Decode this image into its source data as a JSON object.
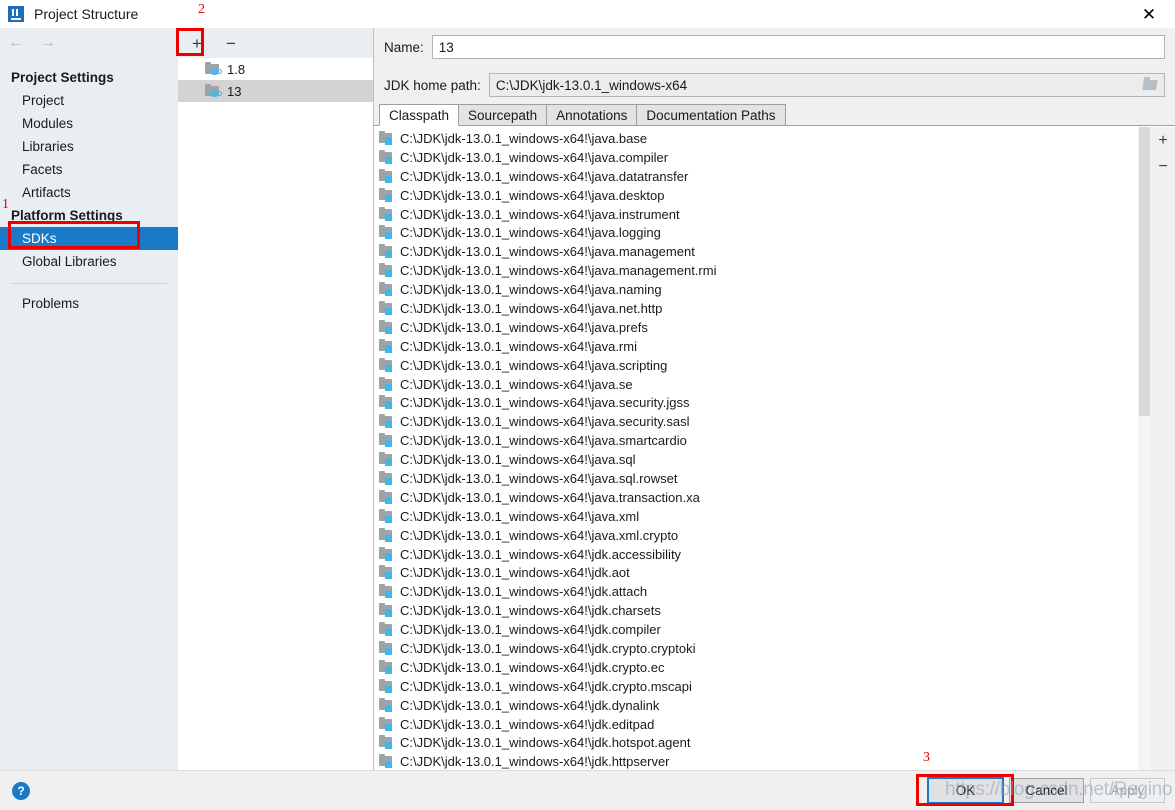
{
  "window": {
    "title": "Project Structure",
    "logo_icon": "intellij-idea-logo-icon",
    "close_icon": "close-icon"
  },
  "navigation": {
    "back_icon": "arrow-left-icon",
    "forward_icon": "arrow-right-icon"
  },
  "sidebar": {
    "groups": [
      {
        "label": "Project Settings",
        "items": [
          {
            "label": "Project",
            "selected": false
          },
          {
            "label": "Modules",
            "selected": false
          },
          {
            "label": "Libraries",
            "selected": false
          },
          {
            "label": "Facets",
            "selected": false
          },
          {
            "label": "Artifacts",
            "selected": false
          }
        ]
      },
      {
        "label": "Platform Settings",
        "items": [
          {
            "label": "SDKs",
            "selected": true
          },
          {
            "label": "Global Libraries",
            "selected": false
          }
        ]
      }
    ],
    "footer_items": [
      {
        "label": "Problems",
        "selected": false
      }
    ],
    "selected_color": "#1a7ac7"
  },
  "sdk_panel": {
    "toolbar": {
      "add_label": "+",
      "add_icon": "plus-icon",
      "remove_label": "−",
      "remove_icon": "minus-icon"
    },
    "items": [
      {
        "label": "1.8",
        "icon": "jdk-folder-icon",
        "selected": false
      },
      {
        "label": "13",
        "icon": "jdk-folder-icon",
        "selected": true
      }
    ]
  },
  "detail": {
    "name_label": "Name:",
    "name_value": "13",
    "jdk_home_label": "JDK home path:",
    "jdk_home_value": "C:\\JDK\\jdk-13.0.1_windows-x64",
    "browse_icon": "folder-browse-icon",
    "tabs": [
      {
        "label": "Classpath",
        "active": true
      },
      {
        "label": "Sourcepath",
        "active": false
      },
      {
        "label": "Annotations",
        "active": false
      },
      {
        "label": "Documentation Paths",
        "active": false
      }
    ],
    "side_buttons": {
      "add_label": "+",
      "add_icon": "plus-icon",
      "remove_label": "−",
      "remove_icon": "minus-icon"
    },
    "classpath_entries": [
      "C:\\JDK\\jdk-13.0.1_windows-x64!\\java.base",
      "C:\\JDK\\jdk-13.0.1_windows-x64!\\java.compiler",
      "C:\\JDK\\jdk-13.0.1_windows-x64!\\java.datatransfer",
      "C:\\JDK\\jdk-13.0.1_windows-x64!\\java.desktop",
      "C:\\JDK\\jdk-13.0.1_windows-x64!\\java.instrument",
      "C:\\JDK\\jdk-13.0.1_windows-x64!\\java.logging",
      "C:\\JDK\\jdk-13.0.1_windows-x64!\\java.management",
      "C:\\JDK\\jdk-13.0.1_windows-x64!\\java.management.rmi",
      "C:\\JDK\\jdk-13.0.1_windows-x64!\\java.naming",
      "C:\\JDK\\jdk-13.0.1_windows-x64!\\java.net.http",
      "C:\\JDK\\jdk-13.0.1_windows-x64!\\java.prefs",
      "C:\\JDK\\jdk-13.0.1_windows-x64!\\java.rmi",
      "C:\\JDK\\jdk-13.0.1_windows-x64!\\java.scripting",
      "C:\\JDK\\jdk-13.0.1_windows-x64!\\java.se",
      "C:\\JDK\\jdk-13.0.1_windows-x64!\\java.security.jgss",
      "C:\\JDK\\jdk-13.0.1_windows-x64!\\java.security.sasl",
      "C:\\JDK\\jdk-13.0.1_windows-x64!\\java.smartcardio",
      "C:\\JDK\\jdk-13.0.1_windows-x64!\\java.sql",
      "C:\\JDK\\jdk-13.0.1_windows-x64!\\java.sql.rowset",
      "C:\\JDK\\jdk-13.0.1_windows-x64!\\java.transaction.xa",
      "C:\\JDK\\jdk-13.0.1_windows-x64!\\java.xml",
      "C:\\JDK\\jdk-13.0.1_windows-x64!\\java.xml.crypto",
      "C:\\JDK\\jdk-13.0.1_windows-x64!\\jdk.accessibility",
      "C:\\JDK\\jdk-13.0.1_windows-x64!\\jdk.aot",
      "C:\\JDK\\jdk-13.0.1_windows-x64!\\jdk.attach",
      "C:\\JDK\\jdk-13.0.1_windows-x64!\\jdk.charsets",
      "C:\\JDK\\jdk-13.0.1_windows-x64!\\jdk.compiler",
      "C:\\JDK\\jdk-13.0.1_windows-x64!\\jdk.crypto.cryptoki",
      "C:\\JDK\\jdk-13.0.1_windows-x64!\\jdk.crypto.ec",
      "C:\\JDK\\jdk-13.0.1_windows-x64!\\jdk.crypto.mscapi",
      "C:\\JDK\\jdk-13.0.1_windows-x64!\\jdk.dynalink",
      "C:\\JDK\\jdk-13.0.1_windows-x64!\\jdk.editpad",
      "C:\\JDK\\jdk-13.0.1_windows-x64!\\jdk.hotspot.agent",
      "C:\\JDK\\jdk-13.0.1_windows-x64!\\jdk.httpserver"
    ]
  },
  "footer": {
    "help_label": "?",
    "help_icon": "help-icon",
    "buttons": [
      {
        "label": "OK",
        "state": "default"
      },
      {
        "label": "Cancel",
        "state": "normal"
      },
      {
        "label": "Apply",
        "state": "disabled"
      }
    ]
  },
  "annotations": [
    {
      "number": "1",
      "target": "sdks-sidebar-item"
    },
    {
      "number": "2",
      "target": "sdk-add-button"
    },
    {
      "number": "3",
      "target": "ok-button"
    }
  ],
  "watermark": "https://blog.csdn.net/Regino"
}
